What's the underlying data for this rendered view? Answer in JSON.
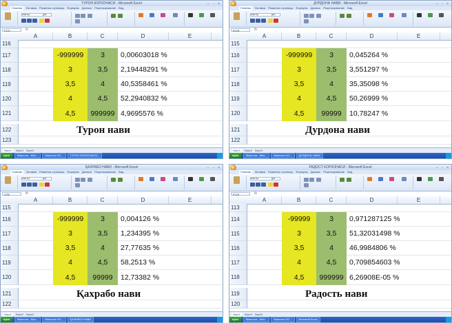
{
  "colors": {
    "yellow_fill": "#e6e622",
    "green_fill": "#9cbd6e",
    "ribbon_bg": "#dbe6f5",
    "taskbar": "#1d4ea7"
  },
  "icons": [
    "office-button-icon",
    "minimize-maximize-close-icons",
    "formula-fx-icon"
  ],
  "ribbon_tabs": [
    "Главная",
    "Вставка",
    "Разметка страницы",
    "Формулы",
    "Данные",
    "Рецензирование",
    "Вид"
  ],
  "ribbon_font": "Arial Cyr",
  "ribbon_font_size": "10",
  "sheet_tabs": [
    "Лист1",
    "Лист2",
    "Лист3"
  ],
  "start_label": "пуск",
  "panels": [
    {
      "title": "ТУРОН КОРХОНАСИ - Microsoft Excel",
      "name_box": "F121",
      "rows": [
        {
          "n": "116"
        },
        {
          "n": "117",
          "b": "-999999",
          "c": "3",
          "d": "0,00603018 %"
        },
        {
          "n": "118",
          "b": "3",
          "c": "3,5",
          "d": "2,19448291 %"
        },
        {
          "n": "119",
          "b": "3,5",
          "c": "4",
          "d": "40,5358461 %"
        },
        {
          "n": "120",
          "b": "4",
          "c": "4,5",
          "d": "52,2940832 %"
        },
        {
          "n": "121",
          "b": "4,5",
          "c": "999999",
          "d": "4,9695576 %"
        },
        {
          "n": "122"
        },
        {
          "n": "123"
        }
      ],
      "caption": "Турон нави",
      "taskbar_items": [
        "Максола - Micr...",
        "Максола ХО...",
        "ТУРОН КОРХОНАСИ..."
      ]
    },
    {
      "title": "ДУРДОНА НАВИ - Microsoft Excel",
      "name_box": "E125",
      "rows": [
        {
          "n": "115"
        },
        {
          "n": "116",
          "b": "-999999",
          "c": "3",
          "d": "0,045264 %"
        },
        {
          "n": "117",
          "b": "3",
          "c": "3,5",
          "d": "3,551297 %"
        },
        {
          "n": "118",
          "b": "3,5",
          "c": "4",
          "d": "35,35098 %"
        },
        {
          "n": "119",
          "b": "4",
          "c": "4,5",
          "d": "50,26999 %"
        },
        {
          "n": "120",
          "b": "4,5",
          "c": "99999",
          "d": "10,78247 %"
        },
        {
          "n": "121"
        },
        {
          "n": "122"
        }
      ],
      "caption": "Дурдона нави",
      "taskbar_items": [
        "Максола - Micr...",
        "Максола ХО...",
        "ДУРДОНА НАВИ"
      ]
    },
    {
      "title": "ҚАХРАБО НАВИ - Microsoft Excel",
      "name_box": "I126",
      "rows": [
        {
          "n": "115"
        },
        {
          "n": "116",
          "b": "-999999",
          "c": "3",
          "d": "0,004126 %"
        },
        {
          "n": "117",
          "b": "3",
          "c": "3,5",
          "d": "1,234395 %"
        },
        {
          "n": "118",
          "b": "3,5",
          "c": "4",
          "d": "27,77635 %"
        },
        {
          "n": "119",
          "b": "4",
          "c": "4,5",
          "d": "58,2513 %"
        },
        {
          "n": "120",
          "b": "4,5",
          "c": "99999",
          "d": "12,73382 %"
        },
        {
          "n": "121"
        },
        {
          "n": "122"
        }
      ],
      "caption": "Қахрабо нави",
      "taskbar_items": [
        "Максола - Micr...",
        "Максола ХО...",
        "ҚАХРАБО НАВИ"
      ]
    },
    {
      "title": "РАДОСТ КОРХОНАСИ - Microsoft Excel",
      "name_box": "F120",
      "rows": [
        {
          "n": "113"
        },
        {
          "n": "114",
          "b": "-99999",
          "c": "3",
          "d": "0,971287125 %"
        },
        {
          "n": "115",
          "b": "3",
          "c": "3,5",
          "d": "51,32031498 %"
        },
        {
          "n": "116",
          "b": "3,5",
          "c": "4",
          "d": "46,9984806 %"
        },
        {
          "n": "117",
          "b": "4",
          "c": "4,5",
          "d": "0,709854603 %"
        },
        {
          "n": "118",
          "b": "4,5",
          "c": "999999",
          "d": "6,26908E-05 %"
        },
        {
          "n": "119"
        },
        {
          "n": "120"
        }
      ],
      "caption": "Радость нави",
      "taskbar_items": [
        "Максола - Micr...",
        "Максола ХО...",
        "Microsoft Excel"
      ]
    }
  ]
}
